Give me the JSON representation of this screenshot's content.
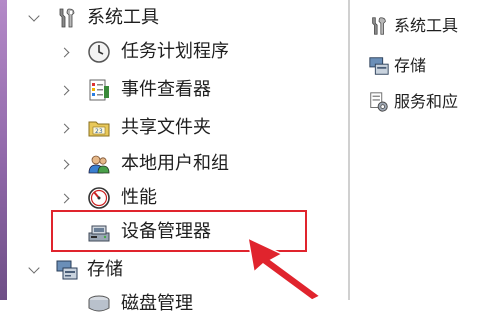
{
  "tree": {
    "items": [
      {
        "label": "系统工具",
        "expanded": true,
        "icon": "tools-icon"
      },
      {
        "label": "任务计划程序",
        "icon": "clock-icon"
      },
      {
        "label": "事件查看器",
        "icon": "event-log-icon"
      },
      {
        "label": "共享文件夹",
        "icon": "shared-folder-icon"
      },
      {
        "label": "本地用户和组",
        "icon": "users-icon"
      },
      {
        "label": "性能",
        "icon": "performance-icon"
      },
      {
        "label": "设备管理器",
        "icon": "device-manager-icon",
        "highlighted": true
      },
      {
        "label": "存储",
        "expanded": true,
        "icon": "storage-icon"
      },
      {
        "label": "磁盘管理",
        "icon": "disk-icon"
      }
    ]
  },
  "right_pane": {
    "items": [
      {
        "label": "系统工具",
        "icon": "tools-icon"
      },
      {
        "label": "存储",
        "icon": "storage-icon"
      },
      {
        "label": "服务和应",
        "icon": "services-icon"
      }
    ]
  },
  "annotation": {
    "box_color": "#e0242d",
    "arrow_color": "#e0242d"
  }
}
